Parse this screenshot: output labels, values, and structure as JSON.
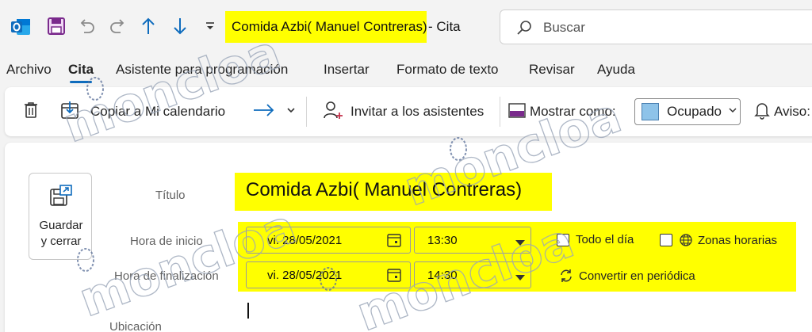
{
  "window": {
    "subject_title": "Comida Azbi( Manuel Contreras)",
    "title_suffix": "- Cita",
    "search_placeholder": "Buscar"
  },
  "menu": {
    "tabs": [
      {
        "label": "Archivo"
      },
      {
        "label": "Cita"
      },
      {
        "label": "Asistente para programación"
      },
      {
        "label": "Insertar"
      },
      {
        "label": "Formato de texto"
      },
      {
        "label": "Revisar"
      },
      {
        "label": "Ayuda"
      }
    ],
    "active": "Cita"
  },
  "ribbon": {
    "copy_to_calendar": "Copiar a Mi calendario",
    "invite_attendees": "Invitar a los asistentes",
    "show_as_label": "Mostrar como:",
    "show_as_value": "Ocupado",
    "reminder_label": "Aviso:"
  },
  "form": {
    "save_close_line1": "Guardar",
    "save_close_line2": "y cerrar",
    "title_label": "Título",
    "subject": "Comida Azbi( Manuel Contreras)",
    "start_label": "Hora de inicio",
    "end_label": "Hora de finalización",
    "location_label": "Ubicación",
    "start_date": "vi. 28/05/2021",
    "start_time": "13:30",
    "end_date": "vi. 28/05/2021",
    "end_time": "14:30",
    "all_day": "Todo el día",
    "time_zones": "Zonas horarias",
    "make_recurring": "Convertir en periódica"
  },
  "watermark": "moncloa",
  "colors": {
    "highlight": "#ffff00",
    "accent": "#0f6cbd",
    "outlook_blue": "#0f6cbd",
    "save_purple": "#7a2a8c"
  }
}
